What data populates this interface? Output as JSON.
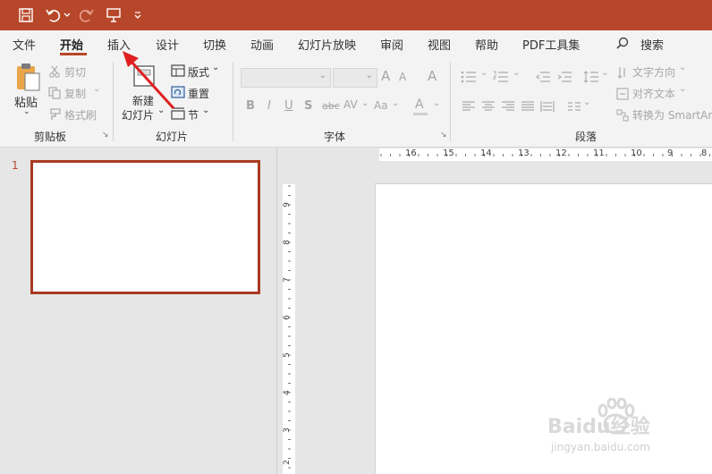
{
  "quick_access": {
    "icons": [
      "save-icon",
      "undo-icon",
      "dropdown-caret-icon",
      "redo-icon",
      "presentation-start-icon",
      "customize-caret-icon"
    ]
  },
  "menu": {
    "tabs": [
      "文件",
      "开始",
      "插入",
      "设计",
      "切换",
      "动画",
      "幻灯片放映",
      "审阅",
      "视图",
      "帮助",
      "PDF工具集"
    ],
    "active_tab": "开始",
    "search_label": "搜索"
  },
  "ribbon": {
    "clipboard": {
      "paste": "粘贴",
      "cut": "剪切",
      "copy": "复制",
      "format_painter": "格式刷",
      "group_label": "剪贴板"
    },
    "slides": {
      "new_slide_line1": "新建",
      "new_slide_line2": "幻灯片",
      "layout": "版式",
      "reset": "重置",
      "section": "节",
      "group_label": "幻灯片"
    },
    "font": {
      "font_name": "",
      "font_size": "",
      "grow": "A",
      "shrink": "A",
      "clear": "A",
      "bold": "B",
      "italic": "I",
      "underline": "U",
      "shadow": "S",
      "strike": "abc",
      "spacing": "AV",
      "case": "Aa",
      "color": "A",
      "group_label": "字体"
    },
    "paragraph": {
      "text_direction": "文字方向",
      "align_text": "对齐文本",
      "convert_smartart": "转换为 SmartArt",
      "group_label": "段落"
    }
  },
  "ruler": {
    "horizontal": [
      "16",
      "15",
      "14",
      "13",
      "12",
      "11",
      "10",
      "9",
      "8"
    ],
    "vertical": [
      "9",
      "8",
      "7",
      "6",
      "5",
      "4",
      "3",
      "2"
    ]
  },
  "thumbnails": [
    {
      "number": "1"
    }
  ],
  "watermark": {
    "brand": "Baidu经验",
    "url": "jingyan.baidu.com"
  },
  "colors": {
    "accent": "#b7472a",
    "ribbon_bg": "#f3f3f3",
    "annotation_arrow": "#e02020"
  }
}
